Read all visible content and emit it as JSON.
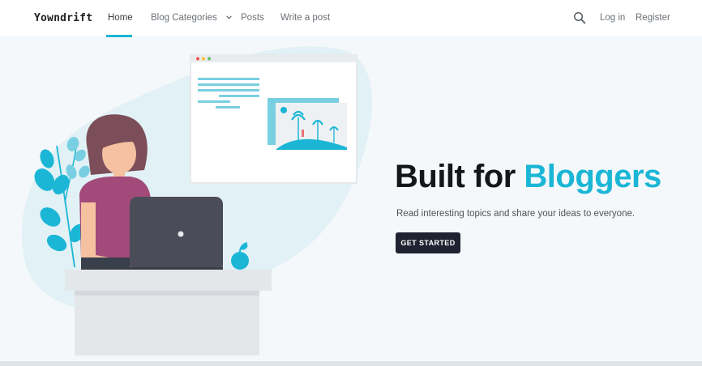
{
  "brand": "Yowndrift",
  "nav": {
    "home": "Home",
    "categories": "Blog Categories",
    "posts": "Posts",
    "write": "Write a post",
    "login": "Log in",
    "register": "Register"
  },
  "hero": {
    "title_main": "Built for ",
    "title_accent": "Bloggers",
    "subtitle": "Read interesting topics and share your ideas to everyone.",
    "cta": "GET STARTED"
  },
  "colors": {
    "accent": "#1bb6d6",
    "button_bg": "#1f2230",
    "page_bg": "#f5f8fa"
  },
  "icons": [
    "search-icon",
    "chevron-down-icon"
  ]
}
